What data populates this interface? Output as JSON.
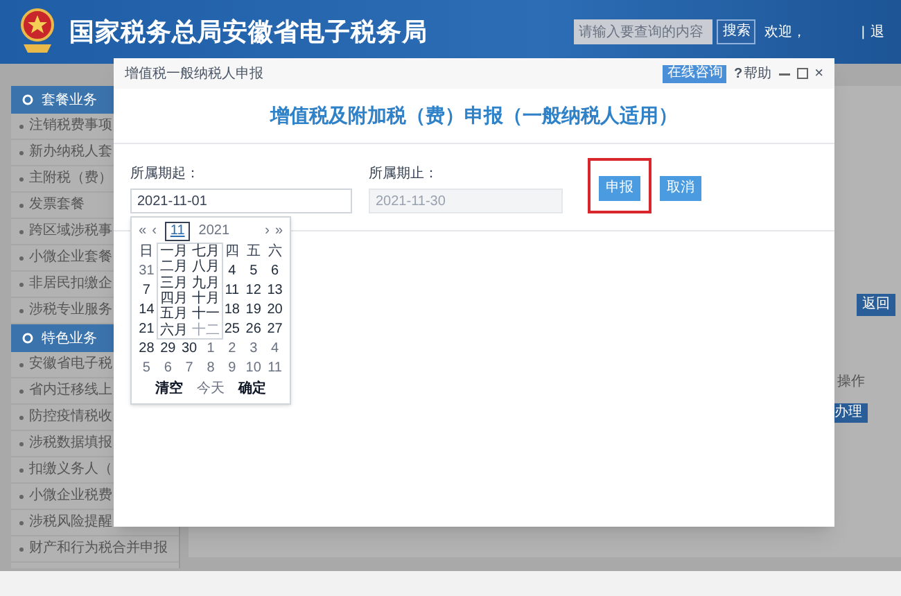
{
  "header": {
    "title": "国家税务总局安徽省电子税务局",
    "search": {
      "placeholder": "请输入要查询的内容"
    },
    "search_button": "搜索",
    "welcome": "欢迎，",
    "separator": "|",
    "logout": "退"
  },
  "sidebar": {
    "sections": [
      {
        "title": "套餐业务",
        "items": [
          "注销税费事项",
          "新办纳税人套",
          "主附税（费）",
          "发票套餐",
          "跨区域涉税事",
          "小微企业套餐",
          "非居民扣缴企",
          "涉税专业服务"
        ]
      },
      {
        "title": "特色业务",
        "items": [
          "安徽省电子税",
          "省内迁移线上",
          "防控疫情税收",
          "涉税数据填报",
          "扣缴义务人（",
          "小微企业税费",
          "涉税风险提醒",
          "财产和行为税合并申报"
        ]
      }
    ]
  },
  "background": {
    "back_button": "返回",
    "column_header": "操作",
    "action_button": "办理"
  },
  "dialog": {
    "title": "增值税一般纳税人申报",
    "consult": "在线咨询",
    "help_mark": "?",
    "help": "帮助",
    "close": "×",
    "heading": "增值税及附加税（费）申报（一般纳税人适用）",
    "fields": [
      {
        "label": "所属期起：",
        "value": "2021-11-01",
        "disabled": false
      },
      {
        "label": "所属期止：",
        "value": "2021-11-30",
        "disabled": true
      }
    ],
    "buttons": [
      {
        "label": "申报",
        "highlighted": true
      },
      {
        "label": "取消",
        "highlighted": false
      }
    ]
  },
  "calendar": {
    "prev": [
      "«",
      "‹"
    ],
    "next": [
      "›",
      "»"
    ],
    "month": "11",
    "year": "2021",
    "weekdays": {
      "lead": [
        "日"
      ],
      "trail": [
        "四",
        "五",
        "六"
      ]
    },
    "weeks": [
      {
        "lead": [
          {
            "day": "31",
            "muted": true
          }
        ],
        "trail": [
          {
            "day": "4",
            "muted": false
          },
          {
            "day": "5",
            "muted": false
          },
          {
            "day": "6",
            "muted": false
          }
        ]
      },
      {
        "lead": [
          {
            "day": "7",
            "muted": false
          }
        ],
        "trail": [
          {
            "day": "11",
            "muted": false
          },
          {
            "day": "12",
            "muted": false
          },
          {
            "day": "13",
            "muted": false
          }
        ]
      },
      {
        "lead": [
          {
            "day": "14",
            "muted": false
          }
        ],
        "trail": [
          {
            "day": "18",
            "muted": false
          },
          {
            "day": "19",
            "muted": false
          },
          {
            "day": "20",
            "muted": false
          }
        ]
      },
      {
        "lead": [
          {
            "day": "21",
            "muted": false
          }
        ],
        "trail": [
          {
            "day": "25",
            "muted": false
          },
          {
            "day": "26",
            "muted": false
          },
          {
            "day": "27",
            "muted": false
          }
        ]
      },
      {
        "lead": [
          {
            "day": "28",
            "muted": false
          },
          {
            "day": "29",
            "muted": false
          },
          {
            "day": "30",
            "muted": false
          },
          {
            "day": "1",
            "muted": true
          },
          {
            "day": "2",
            "muted": true
          },
          {
            "day": "3",
            "muted": true
          },
          {
            "day": "4",
            "muted": true
          }
        ]
      },
      {
        "lead": [
          {
            "day": "5",
            "muted": true
          },
          {
            "day": "6",
            "muted": true
          },
          {
            "day": "7",
            "muted": true
          },
          {
            "day": "8",
            "muted": true
          },
          {
            "day": "9",
            "muted": true
          },
          {
            "day": "10",
            "muted": true
          },
          {
            "day": "11",
            "muted": true
          }
        ]
      }
    ],
    "months": [
      {
        "label": "一月",
        "disabled": false
      },
      {
        "label": "二月",
        "disabled": false
      },
      {
        "label": "三月",
        "disabled": false
      },
      {
        "label": "四月",
        "disabled": false
      },
      {
        "label": "五月",
        "disabled": false
      },
      {
        "label": "六月",
        "disabled": false
      },
      {
        "label": "七月",
        "disabled": false
      },
      {
        "label": "八月",
        "disabled": false
      },
      {
        "label": "九月",
        "disabled": false
      },
      {
        "label": "十月",
        "disabled": false
      },
      {
        "label": "十一",
        "disabled": false
      },
      {
        "label": "十二",
        "disabled": true
      }
    ],
    "footer": [
      {
        "label": "清空",
        "disabled": false
      },
      {
        "label": "今天",
        "disabled": true
      },
      {
        "label": "确定",
        "disabled": false
      }
    ]
  }
}
